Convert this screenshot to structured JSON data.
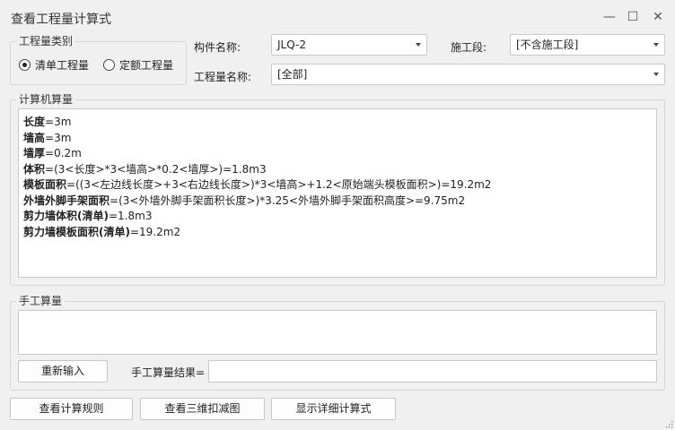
{
  "window": {
    "title": "查看工程量计算式",
    "minimize_glyph": "—",
    "maximize_glyph": "☐",
    "close_glyph": "✕"
  },
  "quantity_type": {
    "legend": "工程量类别",
    "options": [
      {
        "label": "清单工程量",
        "selected": true
      },
      {
        "label": "定额工程量",
        "selected": false
      }
    ]
  },
  "filters": {
    "component_label": "构件名称:",
    "component_value": "JLQ-2",
    "stage_label": "施工段:",
    "stage_value": "[不含施工段]",
    "quantity_name_label": "工程量名称:",
    "quantity_name_value": "[全部]"
  },
  "computer_calc": {
    "legend": "计算机算量",
    "lines": [
      {
        "name": "长度",
        "expr": "=3m"
      },
      {
        "name": "墙高",
        "expr": "=3m"
      },
      {
        "name": "墙厚",
        "expr": "=0.2m"
      },
      {
        "name": "体积",
        "expr": "=(3<长度>*3<墙高>*0.2<墙厚>)=1.8m3"
      },
      {
        "name": "模板面积",
        "expr": "=((3<左边线长度>+3<右边线长度>)*3<墙高>+1.2<原始端头模板面积>)=19.2m2"
      },
      {
        "name": "外墙外脚手架面积",
        "expr": "=(3<外墙外脚手架面积长度>)*3.25<外墙外脚手架面积高度>=9.75m2"
      },
      {
        "name": "剪力墙体积(清单)",
        "expr": "=1.8m3"
      },
      {
        "name": "剪力墙模板面积(清单)",
        "expr": "=19.2m2"
      }
    ]
  },
  "manual_calc": {
    "legend": "手工算量",
    "reenter_button": "重新输入",
    "result_label": "手工算量结果=",
    "result_value": ""
  },
  "footer": {
    "view_rules_button": "查看计算规则",
    "view_3d_button": "查看三维扣减图",
    "show_detail_button": "显示详细计算式"
  }
}
